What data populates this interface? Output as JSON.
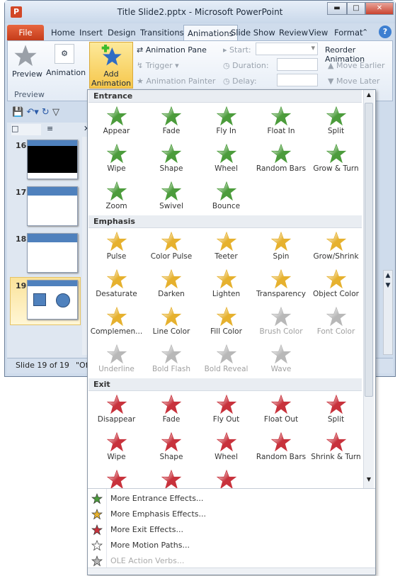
{
  "window": {
    "title": "Title Slide2.pptx - Microsoft PowerPoint",
    "app_icon": "P"
  },
  "tabs": [
    "File",
    "Home",
    "Insert",
    "Design",
    "Transitions",
    "Animations",
    "Slide Show",
    "Review",
    "View",
    "Format"
  ],
  "active_tab": "Animations",
  "ribbon": {
    "preview": "Preview",
    "preview_group": "Preview",
    "animation": "Animation",
    "add_animation_1": "Add",
    "add_animation_2": "Animation",
    "animation_pane": "Animation Pane",
    "trigger": "Trigger",
    "animation_painter": "Animation Painter",
    "start": "Start:",
    "duration": "Duration:",
    "delay": "Delay:",
    "reorder": "Reorder Animation",
    "move_earlier": "Move Earlier",
    "move_later": "Move Later"
  },
  "slides": [
    {
      "num": "16"
    },
    {
      "num": "17"
    },
    {
      "num": "18"
    },
    {
      "num": "19",
      "selected": true
    }
  ],
  "status": {
    "slide": "Slide 19 of 19",
    "theme": "\"Off"
  },
  "colors": {
    "entrance": "#4c9c3c",
    "emphasis": "#e6b12e",
    "exit": "#c8323c",
    "disabled": "#b8b8b8",
    "accent": "#4f81bd"
  },
  "gallery": {
    "entrance": {
      "title": "Entrance",
      "items": [
        {
          "label": "Appear"
        },
        {
          "label": "Fade"
        },
        {
          "label": "Fly In"
        },
        {
          "label": "Float In"
        },
        {
          "label": "Split"
        },
        {
          "label": "Wipe"
        },
        {
          "label": "Shape"
        },
        {
          "label": "Wheel"
        },
        {
          "label": "Random Bars"
        },
        {
          "label": "Grow & Turn"
        },
        {
          "label": "Zoom"
        },
        {
          "label": "Swivel"
        },
        {
          "label": "Bounce"
        }
      ]
    },
    "emphasis": {
      "title": "Emphasis",
      "items": [
        {
          "label": "Pulse"
        },
        {
          "label": "Color Pulse"
        },
        {
          "label": "Teeter"
        },
        {
          "label": "Spin"
        },
        {
          "label": "Grow/Shrink"
        },
        {
          "label": "Desaturate"
        },
        {
          "label": "Darken"
        },
        {
          "label": "Lighten"
        },
        {
          "label": "Transparency"
        },
        {
          "label": "Object Color"
        },
        {
          "label": "Complemen..."
        },
        {
          "label": "Line Color"
        },
        {
          "label": "Fill Color"
        },
        {
          "label": "Brush Color",
          "disabled": true
        },
        {
          "label": "Font Color",
          "disabled": true
        },
        {
          "label": "Underline",
          "disabled": true
        },
        {
          "label": "Bold Flash",
          "disabled": true
        },
        {
          "label": "Bold Reveal",
          "disabled": true
        },
        {
          "label": "Wave",
          "disabled": true
        }
      ]
    },
    "exit": {
      "title": "Exit",
      "items": [
        {
          "label": "Disappear"
        },
        {
          "label": "Fade"
        },
        {
          "label": "Fly Out"
        },
        {
          "label": "Float Out"
        },
        {
          "label": "Split"
        },
        {
          "label": "Wipe"
        },
        {
          "label": "Shape"
        },
        {
          "label": "Wheel"
        },
        {
          "label": "Random Bars"
        },
        {
          "label": "Shrink & Turn"
        },
        {
          "label": ""
        },
        {
          "label": ""
        },
        {
          "label": ""
        }
      ]
    }
  },
  "menu": [
    {
      "label": "More Entrance Effects...",
      "icon": "green-star-icon"
    },
    {
      "label": "More Emphasis Effects...",
      "icon": "yellow-star-icon"
    },
    {
      "label": "More Exit Effects...",
      "icon": "red-star-icon"
    },
    {
      "label": "More Motion Paths...",
      "icon": "outline-star-icon"
    },
    {
      "label": "OLE Action Verbs...",
      "icon": "ole-icon",
      "disabled": true
    }
  ]
}
